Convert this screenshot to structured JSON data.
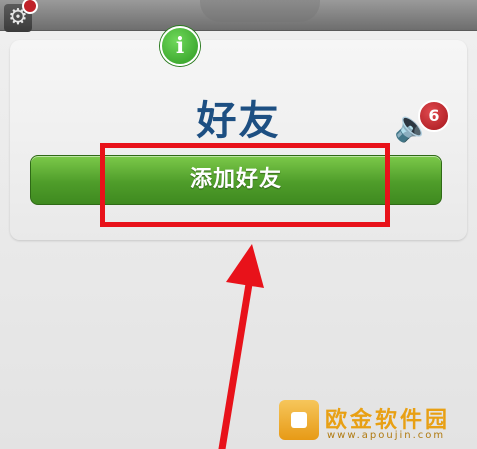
{
  "icons": {
    "settings": "gear-icon",
    "info": "info-icon",
    "sound": "speaker-icon"
  },
  "friends": {
    "title": "好友",
    "add_button": "添加好友",
    "info_glyph": "i",
    "notification_count": "6"
  },
  "watermark": {
    "name": "欧金软件园",
    "url": "www.apoujin.com"
  },
  "colors": {
    "title": "#1d4f82",
    "button": "#4f9d2a",
    "highlight": "#e8121a",
    "badge": "#c0222a"
  }
}
